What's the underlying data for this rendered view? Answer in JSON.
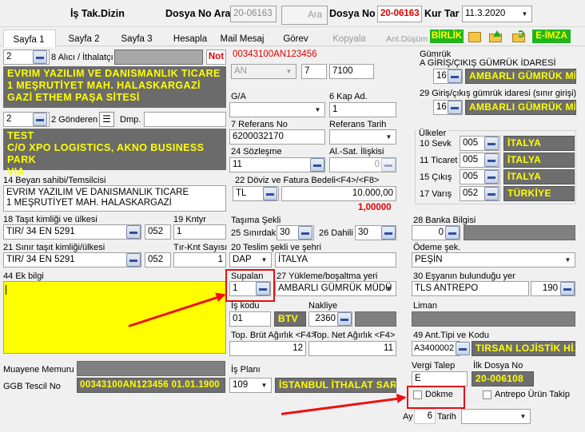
{
  "header": {
    "title": "İş Tak.Dizin",
    "dosya_no_ara_label": "Dosya No Ara",
    "dosya_no_ara_value": "20-06163",
    "ara_button": "Ara",
    "dosya_no_label": "Dosya No",
    "dosya_no_value": "20-06163",
    "kur_tar_label": "Kur Tar",
    "kur_tar_value": "11.3.2020"
  },
  "tabs": [
    "Sayfa 1",
    "Sayfa 2",
    "Sayfa 3",
    "Hesapla",
    "Mail Mesaj",
    "Görev",
    "Kopyala",
    "Ant.Düşüm"
  ],
  "toolbar": {
    "birlik": "BİRLİK",
    "eimza": "E-İMZA"
  },
  "alici": {
    "num": "2",
    "label": "8 Alıcı / İthalatçı",
    "not": "Not",
    "text": [
      "EVRIM YAZILIM VE DANISMANLIK TICARE",
      "1 MEŞRUTİYET MAH. HALASKARGAZİ",
      "GAZİ ETHEM PAŞA SİTESİ"
    ]
  },
  "gonderen": {
    "num": "2",
    "label": "2 Gönderen",
    "dmp_label": "Dmp.",
    "text": [
      "TEST",
      "C/O XPO LOGISTICS, AKNO BUSINESS PARK",
      "VIA"
    ]
  },
  "beyan": {
    "label": "14 Beyan sahibi/Temsilcisi",
    "lines": [
      "EVRIM YAZILIM VE DANISMANLIK TICARE",
      "1 MEŞRUTİYET MAH. HALASKARGAZİ"
    ]
  },
  "tasit": {
    "label": "18 Taşıt kimliği ve ülkesi",
    "value": "TIR/ 34 EN 5291",
    "country": "052",
    "kntyr_label": "19 Kntyr",
    "kntyr_value": "1"
  },
  "sinir_tasit": {
    "label": "21 Sınır taşıt kimliği/ülkesi",
    "value": "TIR/ 34 EN 5291",
    "country": "052",
    "count_label": "Tır-Knt Sayısı",
    "count_value": "1"
  },
  "ek_bilgi": {
    "label": "44 Ek bilgi"
  },
  "muayene_label": "Muayene Memuru",
  "ggb": {
    "label": "GGB Tescil No",
    "value": "00343100AN123456 01.01.1900"
  },
  "ref": {
    "code": "00343100AN123456",
    "an": "AN",
    "n7": "7",
    "n7100": "7100"
  },
  "ga": {
    "label": "G/A",
    "kap_label": "6 Kap Ad.",
    "kap_value": "1"
  },
  "referans": {
    "label": "7 Referans No",
    "value": "6200032170",
    "tarih_label": "Referans Tarih"
  },
  "sozlesme": {
    "label": "24 Sözleşme",
    "value": "11",
    "alsat_label": "Al.-Sat. İlişkisi",
    "alsat_value": "0"
  },
  "doviz": {
    "label": "22 Döviz ve Fatura Bedeli<F4>/<F8>",
    "currency": "TL",
    "amount": "10.000,00",
    "rate": "1,00000"
  },
  "tasima": {
    "label": "Taşıma Şekli",
    "sinir_label": "25 Sınırdaki",
    "sinir_value": "30",
    "dahili_label": "26 Dahili",
    "dahili_value": "30"
  },
  "teslim": {
    "label": "20 Teslim şekli ve şehri",
    "value": "DAP",
    "city": "İTALYA"
  },
  "supalan": {
    "label": "Supalan",
    "value": "1"
  },
  "yukleme": {
    "label": "27 Yükleme/boşaltma yeri",
    "value": "AMBARLI  GÜMRÜK MÜDÜ"
  },
  "is_kodu": {
    "label": "İş kodu",
    "value": "01",
    "btv": "BTV",
    "nakliye_label": "Nakliye",
    "nakliye_value": "2360"
  },
  "agirlik": {
    "brut_label": "Top. Brüt Ağırlık <F4>",
    "brut_value": "12",
    "net_label": "Top. Net Ağırlık <F4>",
    "net_value": "11"
  },
  "is_plani": {
    "label": "İş Planı",
    "value": "109",
    "desc": "İSTANBUL İTHALAT SARI"
  },
  "gumruk": {
    "label": "Gümrük",
    "sub": "A GİRİŞ/ÇIKIŞ GÜMRÜK İDARESİ",
    "num": "16",
    "name": "AMBARLI  GÜMRÜK Mİ",
    "label29": "29 Giriş/çıkış gümrük idaresi (sınır girişi)",
    "num29": "16",
    "name29": "AMBARLI  GÜMRÜK Mİ"
  },
  "ulkeler": {
    "label": "Ülkeler",
    "rows": [
      {
        "label": "10 Sevk",
        "code": "005",
        "name": "İTALYA"
      },
      {
        "label": "11 Ticaret",
        "code": "005",
        "name": "İTALYA"
      },
      {
        "label": "15 Çıkış",
        "code": "005",
        "name": "İTALYA"
      },
      {
        "label": "17 Varış",
        "code": "052",
        "name": "TÜRKİYE"
      }
    ]
  },
  "banka": {
    "label": "28 Banka Bilgisi",
    "value": "0"
  },
  "odeme": {
    "label": "Ödeme şek.",
    "value": "PEŞİN"
  },
  "esya": {
    "label": "30 Eşyanın bulunduğu yer",
    "value": "TLS ANTREPO",
    "num": "190"
  },
  "liman_label": "Liman",
  "ant_tipi": {
    "label": "49 Ant.Tipi ve Kodu",
    "code": "A3400002",
    "name": "TIRSAN LOJİSTİK HİZ"
  },
  "vergi": {
    "label": "Vergi Talep",
    "value": "E",
    "ilk_label": "İlk Dosya No",
    "ilk_value": "20-006108"
  },
  "dokme": {
    "label": "Dökme",
    "antrepo_label": "Antrepo Ürün Takip"
  },
  "ay": {
    "label": "Ay",
    "value": "6",
    "tarih_label": "Tarih"
  },
  "colors": {
    "annotation": "#e11111",
    "yellow_text": "#ffff00",
    "red_text": "#e00000",
    "highlight_box": "#ffff00"
  }
}
